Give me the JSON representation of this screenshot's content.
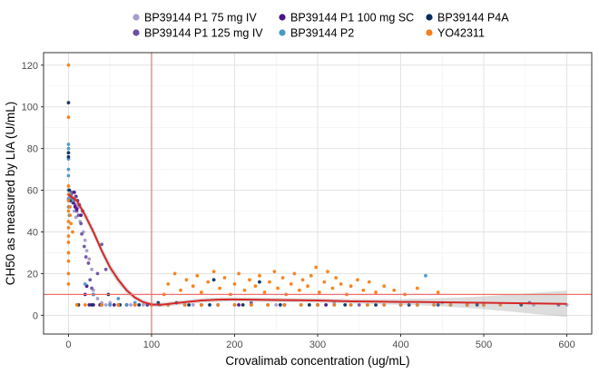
{
  "chart_data": {
    "type": "scatter",
    "xlabel": "Crovalimab concentration (ug/mL)",
    "ylabel": "CH50 as measured by LIA (U/mL)",
    "xlim": [
      -30,
      630
    ],
    "ylim": [
      -9,
      126
    ],
    "x_ticks": [
      0,
      100,
      200,
      300,
      400,
      500,
      600
    ],
    "y_ticks": [
      0,
      20,
      40,
      60,
      80,
      100,
      120
    ],
    "grid": true,
    "legend_position": "top",
    "reference_lines": {
      "vertical_x": 100,
      "horizontal_y": 10,
      "color": "#ef6f6f"
    },
    "series": [
      {
        "name": "BP39144 P1 75 mg IV",
        "color": "#a49cc9",
        "points": [
          [
            1,
            55
          ],
          [
            2,
            52
          ],
          [
            3,
            57
          ],
          [
            5,
            54
          ],
          [
            7,
            50
          ],
          [
            9,
            47
          ],
          [
            12,
            52
          ],
          [
            14,
            45
          ],
          [
            18,
            40
          ],
          [
            20,
            36
          ],
          [
            22,
            31
          ],
          [
            25,
            27
          ],
          [
            28,
            22
          ],
          [
            30,
            12
          ],
          [
            35,
            8
          ],
          [
            40,
            6
          ],
          [
            45,
            5
          ],
          [
            50,
            6
          ],
          [
            60,
            5
          ],
          [
            75,
            5
          ],
          [
            90,
            5
          ],
          [
            110,
            5
          ],
          [
            150,
            5
          ],
          [
            250,
            5
          ],
          [
            320,
            6
          ],
          [
            400,
            5
          ],
          [
            450,
            6
          ],
          [
            560,
            5
          ],
          [
            600,
            5
          ]
        ]
      },
      {
        "name": "BP39144 P1 125 mg IV",
        "color": "#6a52a3",
        "points": [
          [
            2,
            57
          ],
          [
            4,
            59
          ],
          [
            6,
            55
          ],
          [
            8,
            53
          ],
          [
            10,
            50
          ],
          [
            12,
            48
          ],
          [
            15,
            44
          ],
          [
            16,
            39
          ],
          [
            19,
            33
          ],
          [
            21,
            28
          ],
          [
            24,
            25
          ],
          [
            26,
            17
          ],
          [
            28,
            13
          ],
          [
            30,
            10
          ],
          [
            35,
            20
          ],
          [
            40,
            34
          ],
          [
            45,
            22
          ],
          [
            50,
            5
          ],
          [
            60,
            5
          ],
          [
            80,
            5
          ],
          [
            120,
            5
          ],
          [
            180,
            5
          ],
          [
            220,
            6
          ],
          [
            300,
            5
          ],
          [
            350,
            5
          ],
          [
            420,
            5
          ],
          [
            480,
            5
          ],
          [
            555,
            6
          ],
          [
            590,
            5
          ]
        ]
      },
      {
        "name": "BP39144 P1 100 mg SC",
        "color": "#4a1486",
        "points": [
          [
            3,
            58
          ],
          [
            5,
            56
          ],
          [
            6,
            54
          ],
          [
            7,
            59
          ],
          [
            8,
            52
          ],
          [
            9,
            57
          ],
          [
            10,
            51
          ],
          [
            11,
            55
          ],
          [
            13,
            53
          ],
          [
            15,
            48
          ],
          [
            17,
            50
          ],
          [
            20,
            10
          ],
          [
            22,
            14
          ],
          [
            25,
            5
          ],
          [
            30,
            5
          ],
          [
            38,
            5
          ],
          [
            55,
            5
          ],
          [
            70,
            5
          ],
          [
            95,
            5
          ],
          [
            130,
            6
          ],
          [
            160,
            5
          ],
          [
            205,
            5
          ],
          [
            260,
            5
          ],
          [
            310,
            5
          ]
        ]
      },
      {
        "name": "BP39144 P2",
        "color": "#4a98c9",
        "points": [
          [
            0,
            82
          ],
          [
            0,
            80
          ],
          [
            0,
            75
          ],
          [
            0,
            70
          ],
          [
            0,
            67
          ],
          [
            0,
            60
          ],
          [
            0,
            56
          ],
          [
            0,
            52
          ],
          [
            1,
            48
          ],
          [
            2,
            58
          ],
          [
            4,
            55
          ],
          [
            20,
            15
          ],
          [
            30,
            10
          ],
          [
            40,
            5
          ],
          [
            50,
            5
          ],
          [
            60,
            8
          ],
          [
            70,
            5
          ],
          [
            80,
            6
          ],
          [
            100,
            5
          ],
          [
            120,
            5
          ],
          [
            140,
            5
          ],
          [
            160,
            5
          ],
          [
            180,
            5
          ],
          [
            200,
            5
          ],
          [
            220,
            5
          ],
          [
            240,
            5
          ],
          [
            260,
            5
          ],
          [
            280,
            5
          ],
          [
            300,
            5
          ],
          [
            320,
            5
          ],
          [
            340,
            5
          ],
          [
            360,
            5
          ],
          [
            380,
            5
          ],
          [
            400,
            5
          ],
          [
            420,
            5
          ],
          [
            440,
            5
          ],
          [
            460,
            5
          ],
          [
            480,
            5
          ],
          [
            500,
            5
          ],
          [
            430,
            19
          ]
        ]
      },
      {
        "name": "BP39144 P4A",
        "color": "#0b2d5e",
        "points": [
          [
            0,
            102
          ],
          [
            0,
            78
          ],
          [
            0,
            76
          ],
          [
            1,
            60
          ],
          [
            2,
            55
          ],
          [
            12,
            5
          ],
          [
            28,
            5
          ],
          [
            48,
            10
          ],
          [
            62,
            5
          ],
          [
            85,
            5
          ],
          [
            108,
            6
          ],
          [
            145,
            5
          ],
          [
            170,
            5
          ],
          [
            175,
            17
          ],
          [
            210,
            5
          ],
          [
            230,
            16
          ],
          [
            255,
            5
          ],
          [
            290,
            5
          ],
          [
            333,
            5
          ],
          [
            370,
            5
          ],
          [
            410,
            5
          ],
          [
            445,
            5
          ],
          [
            492,
            5
          ],
          [
            545,
            5
          ]
        ]
      },
      {
        "name": "YO42311",
        "color": "#f57f17",
        "points": [
          [
            0,
            120
          ],
          [
            0,
            95
          ],
          [
            0,
            62
          ],
          [
            0,
            58
          ],
          [
            0,
            55
          ],
          [
            0,
            50
          ],
          [
            0,
            45
          ],
          [
            0,
            42
          ],
          [
            0,
            38
          ],
          [
            0,
            35
          ],
          [
            0,
            30
          ],
          [
            0,
            26
          ],
          [
            0,
            20
          ],
          [
            0,
            15
          ],
          [
            1,
            52
          ],
          [
            2,
            48
          ],
          [
            3,
            44
          ],
          [
            5,
            40
          ],
          [
            10,
            5
          ],
          [
            20,
            5
          ],
          [
            40,
            5
          ],
          [
            60,
            5
          ],
          [
            80,
            5
          ],
          [
            100,
            5
          ],
          [
            120,
            5
          ],
          [
            140,
            5
          ],
          [
            160,
            5
          ],
          [
            180,
            5
          ],
          [
            200,
            5
          ],
          [
            220,
            5
          ],
          [
            240,
            5
          ],
          [
            260,
            5
          ],
          [
            280,
            5
          ],
          [
            300,
            5
          ],
          [
            320,
            5
          ],
          [
            340,
            5
          ],
          [
            360,
            5
          ],
          [
            380,
            5
          ],
          [
            400,
            5
          ],
          [
            420,
            5
          ],
          [
            440,
            5
          ],
          [
            460,
            5
          ],
          [
            480,
            5
          ],
          [
            500,
            5
          ],
          [
            520,
            5
          ],
          [
            115,
            10
          ],
          [
            120,
            15
          ],
          [
            128,
            20
          ],
          [
            135,
            12
          ],
          [
            142,
            17
          ],
          [
            150,
            14
          ],
          [
            155,
            19
          ],
          [
            160,
            11
          ],
          [
            168,
            16
          ],
          [
            175,
            21
          ],
          [
            182,
            13
          ],
          [
            188,
            18
          ],
          [
            195,
            10
          ],
          [
            200,
            15
          ],
          [
            205,
            20
          ],
          [
            212,
            12
          ],
          [
            218,
            17
          ],
          [
            225,
            14
          ],
          [
            230,
            19
          ],
          [
            236,
            11
          ],
          [
            242,
            16
          ],
          [
            248,
            21
          ],
          [
            252,
            13
          ],
          [
            258,
            18
          ],
          [
            262,
            10
          ],
          [
            268,
            15
          ],
          [
            272,
            20
          ],
          [
            278,
            12
          ],
          [
            282,
            17
          ],
          [
            288,
            14
          ],
          [
            292,
            19
          ],
          [
            298,
            23
          ],
          [
            302,
            11
          ],
          [
            308,
            16
          ],
          [
            312,
            21
          ],
          [
            318,
            13
          ],
          [
            322,
            18
          ],
          [
            328,
            15
          ],
          [
            335,
            10
          ],
          [
            340,
            14
          ],
          [
            348,
            17
          ],
          [
            355,
            12
          ],
          [
            362,
            16
          ],
          [
            370,
            11
          ],
          [
            380,
            14
          ],
          [
            392,
            12
          ],
          [
            405,
            10
          ],
          [
            420,
            13
          ],
          [
            445,
            11
          ]
        ]
      }
    ],
    "smooth_line": {
      "color": "#d62728",
      "x": [
        0,
        10,
        20,
        30,
        40,
        50,
        60,
        70,
        80,
        90,
        100,
        110,
        120,
        140,
        160,
        180,
        200,
        220,
        240,
        260,
        280,
        300,
        320,
        340,
        360,
        380,
        400,
        420,
        440,
        460,
        480,
        500,
        520,
        540,
        560,
        580,
        600
      ],
      "y": [
        58,
        55,
        48,
        40,
        31,
        23,
        17,
        12,
        8.5,
        6.3,
        5.2,
        5,
        5.4,
        6.3,
        7.1,
        7.5,
        7.6,
        7.5,
        7.4,
        7.3,
        7.2,
        7.1,
        6.9,
        6.7,
        6.6,
        6.5,
        6.4,
        6.4,
        6.3,
        6.2,
        6.1,
        6,
        5.9,
        5.8,
        5.7,
        5.6,
        5.5
      ],
      "ci_low": [
        56,
        53,
        46,
        38,
        29,
        21,
        15,
        10.5,
        7.2,
        5.1,
        4.1,
        3.9,
        4.3,
        5.2,
        6,
        6.4,
        6.6,
        6.5,
        6.4,
        6.3,
        6.2,
        6,
        5.8,
        5.6,
        5.4,
        5.2,
        5,
        4.8,
        4.5,
        4,
        3.5,
        2.9,
        2.2,
        1.5,
        0.7,
        -0.1,
        -0.8
      ],
      "ci_high": [
        60,
        57,
        50,
        42,
        33,
        25,
        19,
        13.5,
        9.8,
        7.5,
        6.3,
        6.1,
        6.5,
        7.4,
        8.2,
        8.6,
        8.6,
        8.5,
        8.4,
        8.3,
        8.2,
        8.2,
        8,
        7.8,
        7.8,
        7.8,
        7.8,
        8,
        8.1,
        8.4,
        8.7,
        9.1,
        9.6,
        10.1,
        10.7,
        11.3,
        11.8
      ]
    }
  }
}
